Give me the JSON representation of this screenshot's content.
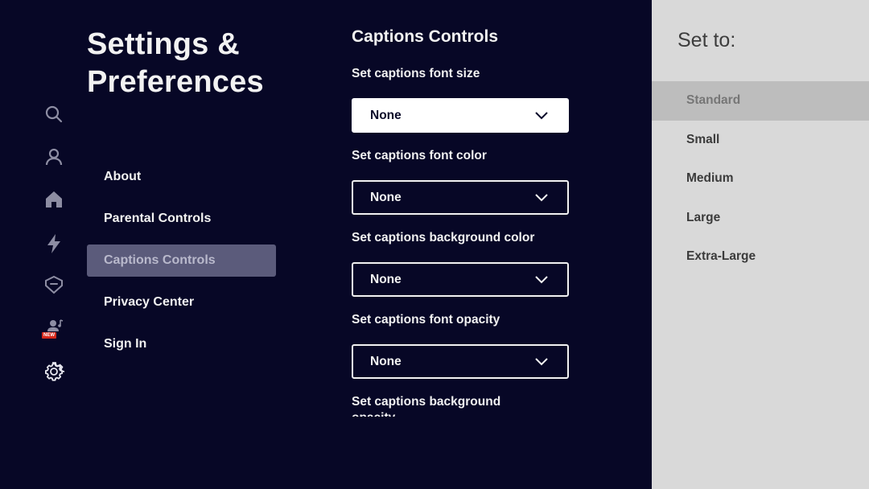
{
  "nav_icons": [
    "search-icon",
    "profile-icon",
    "home-icon",
    "lightning-icon",
    "tag-icon",
    "music-user-icon",
    "settings-icon"
  ],
  "new_badge": "NEW",
  "page_title": "Settings & Preferences",
  "menu": [
    {
      "label": "About",
      "active": false
    },
    {
      "label": "Parental Controls",
      "active": false
    },
    {
      "label": "Captions Controls",
      "active": true
    },
    {
      "label": "Privacy Center",
      "active": false
    },
    {
      "label": "Sign In",
      "active": false
    }
  ],
  "captions": {
    "title": "Captions Controls",
    "settings": [
      {
        "label": "Set captions font size",
        "value": "None",
        "focused": true
      },
      {
        "label": "Set captions font color",
        "value": "None",
        "focused": false
      },
      {
        "label": "Set captions background color",
        "value": "None",
        "focused": false
      },
      {
        "label": "Set captions font opacity",
        "value": "None",
        "focused": false
      },
      {
        "label": "Set captions background opacity",
        "value": "",
        "focused": false
      }
    ]
  },
  "panel": {
    "title": "Set to:",
    "options": [
      "Standard",
      "Small",
      "Medium",
      "Large",
      "Extra-Large"
    ],
    "selected_index": 0
  },
  "colors": {
    "background": "#070726",
    "active_menu": "#5b5b7b",
    "panel_bg": "#d9d9d9",
    "panel_selected": "#bdbdbd",
    "badge": "#d5281b"
  }
}
